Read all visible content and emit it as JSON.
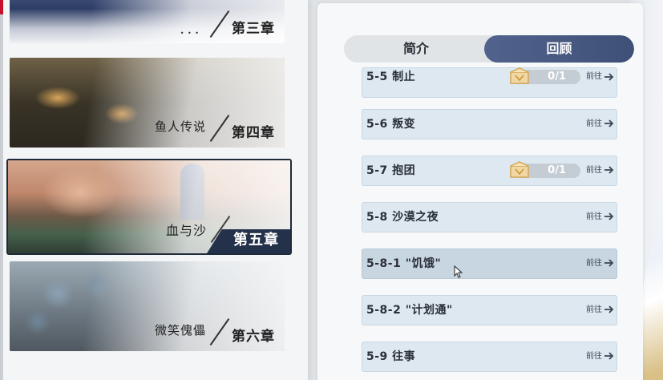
{
  "chapters": [
    {
      "id": "ch3",
      "title": "",
      "number": "第三章"
    },
    {
      "id": "ch4",
      "title": "鱼人传说",
      "number": "第四章"
    },
    {
      "id": "ch5",
      "title": "血与沙",
      "number": "第五章",
      "selected": true
    },
    {
      "id": "ch6",
      "title": "微笑傀儡",
      "number": "第六章"
    }
  ],
  "tabs": {
    "intro": "简介",
    "review": "回顾",
    "active": "review"
  },
  "quests": [
    {
      "name": "5-5 制止",
      "go": "前往",
      "reward": "0/1"
    },
    {
      "name": "5-6 叛变",
      "go": "前往"
    },
    {
      "name": "5-7 抱团",
      "go": "前往",
      "reward": "0/1"
    },
    {
      "name": "5-8 沙漠之夜",
      "go": "前往"
    },
    {
      "name": "5-8-1 \"饥饿\"",
      "go": "前往",
      "selected": true
    },
    {
      "name": "5-8-2 \"计划通\"",
      "go": "前往"
    },
    {
      "name": "5-9 往事",
      "go": "前往"
    }
  ],
  "colors": {
    "accent": "#3f5078",
    "quest_bg": "#dde8f1",
    "chapter_tag": "#23324a"
  },
  "icons": {
    "go": "arrow-right-icon",
    "reward": "treasure-chest-icon",
    "corner": "app-corner-icon"
  }
}
